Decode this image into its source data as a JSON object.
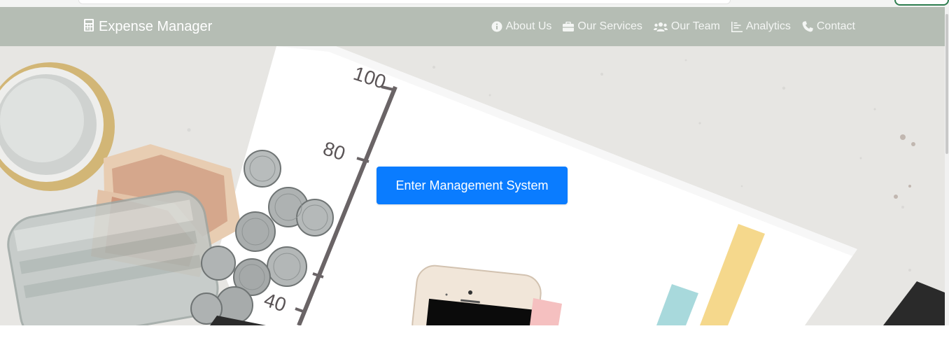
{
  "brand": {
    "title": "Expense Manager",
    "icon": "calculator-icon"
  },
  "nav": {
    "items": [
      {
        "label": "About Us",
        "icon": "info-circle-icon"
      },
      {
        "label": "Our Services",
        "icon": "briefcase-icon"
      },
      {
        "label": "Our Team",
        "icon": "users-icon"
      },
      {
        "label": "Analytics",
        "icon": "chart-icon"
      },
      {
        "label": "Contact",
        "icon": "phone-icon"
      }
    ]
  },
  "hero": {
    "cta_label": "Enter Management System",
    "ruler_labels": [
      "100",
      "80",
      "40"
    ]
  },
  "colors": {
    "navbar_bg": "#b5bdb4",
    "cta_bg": "#0a7cff",
    "nav_text": "#f4f6f4"
  }
}
